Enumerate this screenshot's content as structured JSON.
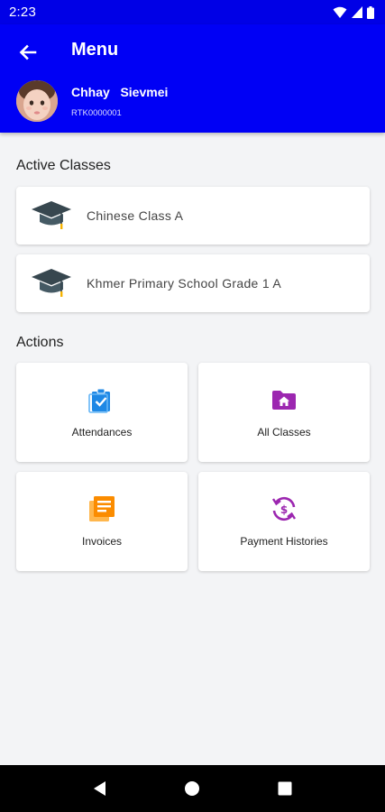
{
  "status_bar": {
    "time": "2:23",
    "icons": [
      "wifi-icon",
      "signal-icon",
      "battery-icon"
    ]
  },
  "app_bar": {
    "title": "Menu",
    "back_icon": "arrow-back-icon",
    "user": {
      "name": "Chhay   Sievmei",
      "id": "RTK0000001"
    }
  },
  "active_classes": {
    "title": "Active Classes",
    "items": [
      {
        "label": "Chinese Class A",
        "icon": "graduation-cap-icon"
      },
      {
        "label": "Khmer Primary School Grade 1 A",
        "icon": "graduation-cap-icon"
      }
    ]
  },
  "actions": {
    "title": "Actions",
    "items": [
      {
        "label": "Attendances",
        "icon": "clipboard-check-icon",
        "color": "#2196f3"
      },
      {
        "label": "All Classes",
        "icon": "folder-home-icon",
        "color": "#9c27b0"
      },
      {
        "label": "Invoices",
        "icon": "invoice-list-icon",
        "color": "#ff9800"
      },
      {
        "label": "Payment Histories",
        "icon": "payment-history-icon",
        "color": "#9c27b0"
      }
    ]
  },
  "colors": {
    "primary": "#0000f5",
    "status_bar": "#0000e6",
    "background": "#f3f4f6"
  },
  "nav_bar": {
    "items": [
      "back-triangle-icon",
      "home-circle-icon",
      "recents-square-icon"
    ]
  }
}
